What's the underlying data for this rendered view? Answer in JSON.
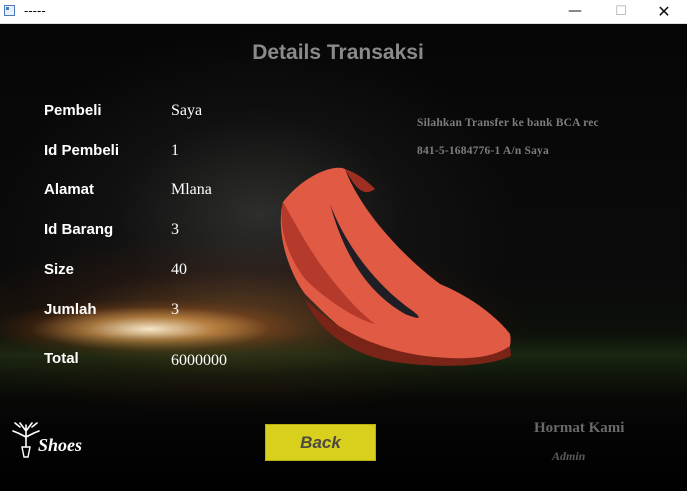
{
  "window": {
    "title": "-----",
    "min": "—",
    "max": "☐",
    "close": "✕"
  },
  "page": {
    "title": "Details Transaksi"
  },
  "details": [
    {
      "label": "Pembeli",
      "value": "Saya"
    },
    {
      "label": "Id Pembeli",
      "value": "1"
    },
    {
      "label": "Alamat",
      "value": "Mlana"
    },
    {
      "label": "Id Barang",
      "value": "3"
    },
    {
      "label": "Size",
      "value": "40"
    },
    {
      "label": "Jumlah",
      "value": "3"
    }
  ],
  "total": {
    "label": "Total",
    "value": "6000000"
  },
  "payment": {
    "line1": "Silahkan Transfer ke bank BCA rec",
    "line2": "841-5-1684776-1   A/n  Saya"
  },
  "buttons": {
    "back": "Back"
  },
  "footer": {
    "hormat": "Hormat Kami",
    "admin": "Admin"
  },
  "logo": {
    "text": "Shoes"
  },
  "colors": {
    "accent_button": "#d8d01c",
    "title": "#8a8a8a",
    "shoe": "#e05a44"
  }
}
